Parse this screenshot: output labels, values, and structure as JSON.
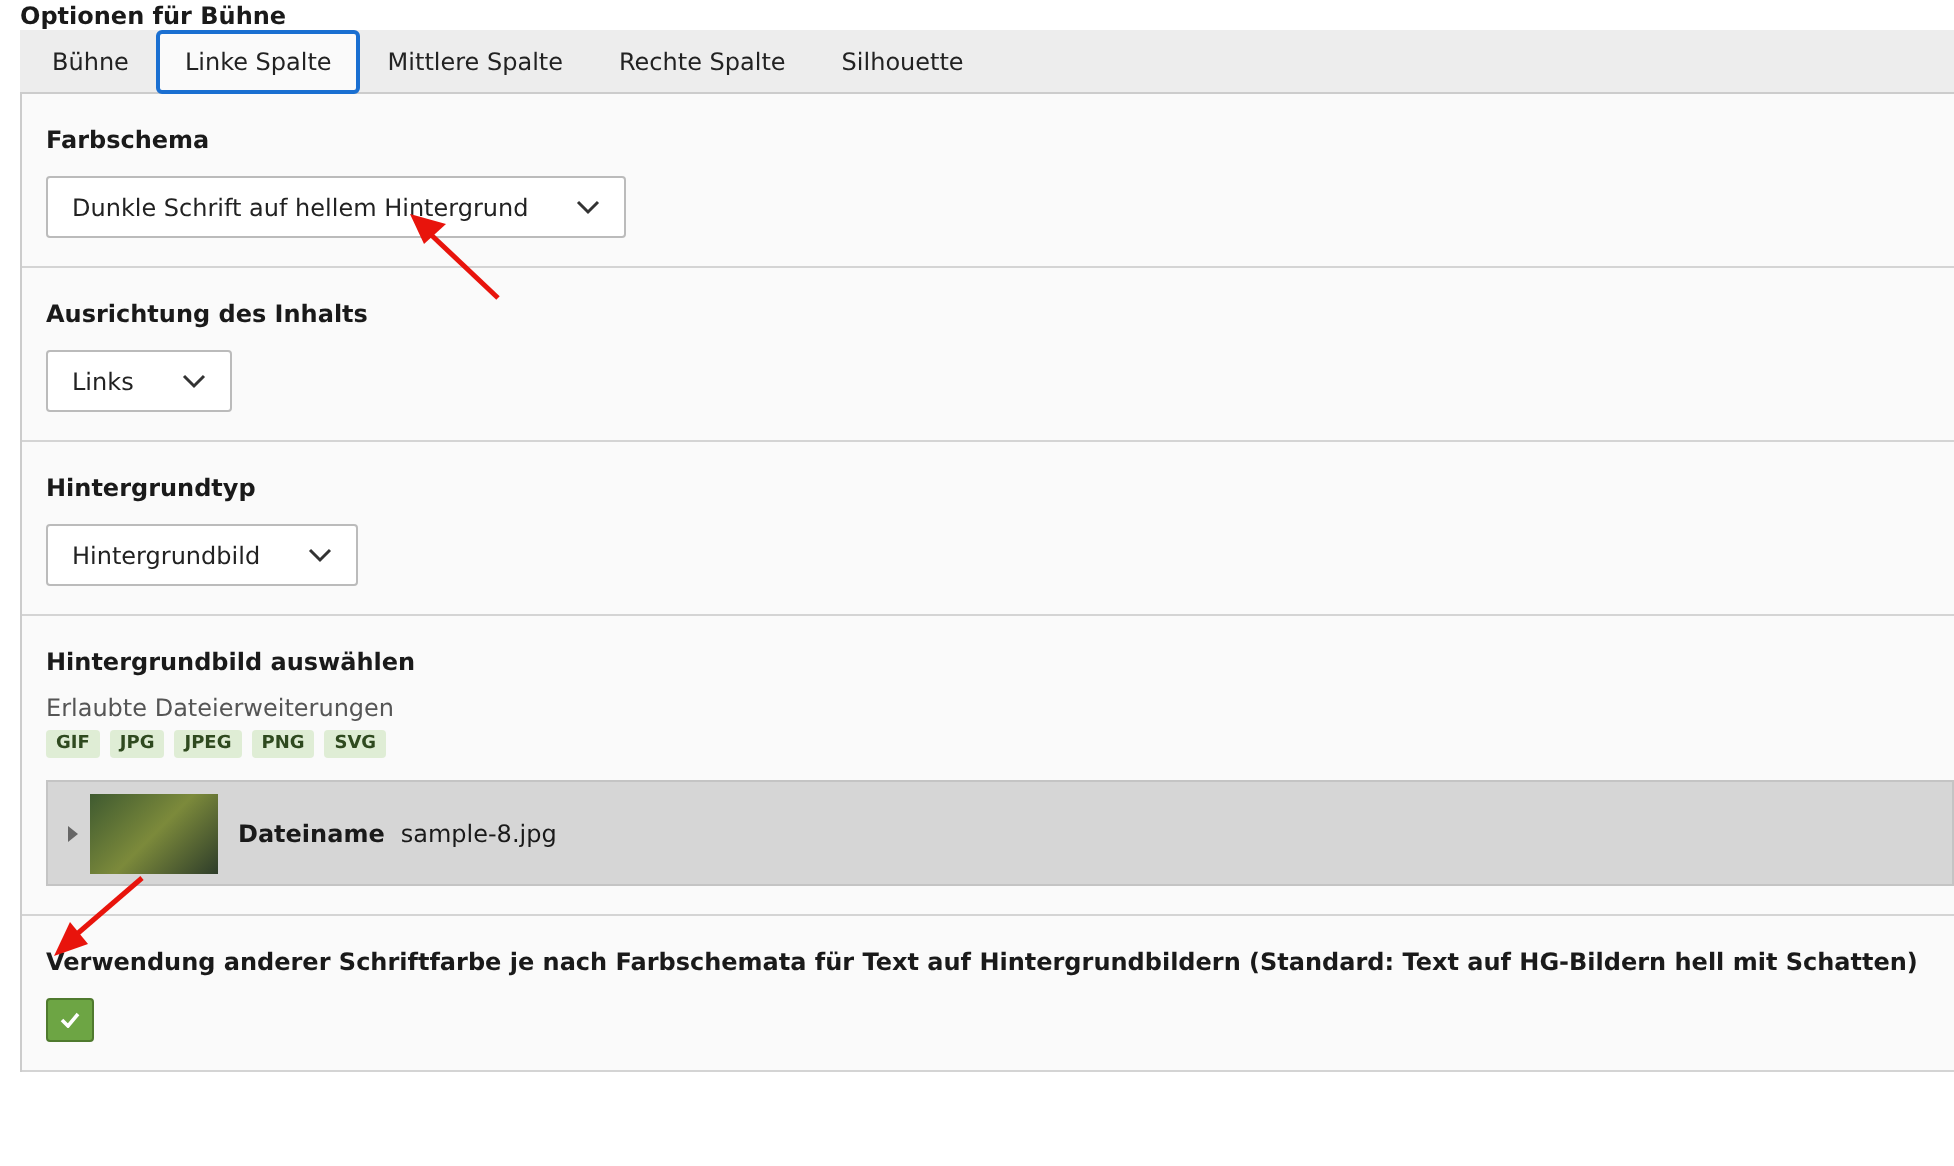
{
  "heading": "Optionen für Bühne",
  "tabs": [
    {
      "label": "Bühne",
      "selected": false
    },
    {
      "label": "Linke Spalte",
      "selected": true
    },
    {
      "label": "Mittlere Spalte",
      "selected": false
    },
    {
      "label": "Rechte Spalte",
      "selected": false
    },
    {
      "label": "Silhouette",
      "selected": false
    }
  ],
  "fields": [
    {
      "kind": "select",
      "label": "Farbschema",
      "value": "Dunkle Schrift auf hellem Hintergrund",
      "annotated": true
    },
    {
      "kind": "select",
      "label": "Ausrichtung des Inhalts",
      "value": "Links",
      "annotated": false
    },
    {
      "kind": "select",
      "label": "Hintergrundtyp",
      "value": "Hintergrundbild",
      "annotated": false
    },
    {
      "kind": "file",
      "label": "Hintergrundbild auswählen",
      "allowed_label": "Erlaubte Dateierweiterungen",
      "extensions": [
        "GIF",
        "JPG",
        "JPEG",
        "PNG",
        "SVG"
      ],
      "file_label": "Dateiname",
      "file_name": "sample-8.jpg",
      "expanded": false
    },
    {
      "kind": "checkbox",
      "label": "Verwendung anderer Schriftfarbe je nach Farbschemata für Text auf Hintergrundbildern (Standard: Text auf HG-Bildern hell mit Schatten)",
      "checked": true,
      "annotated": true
    }
  ]
}
